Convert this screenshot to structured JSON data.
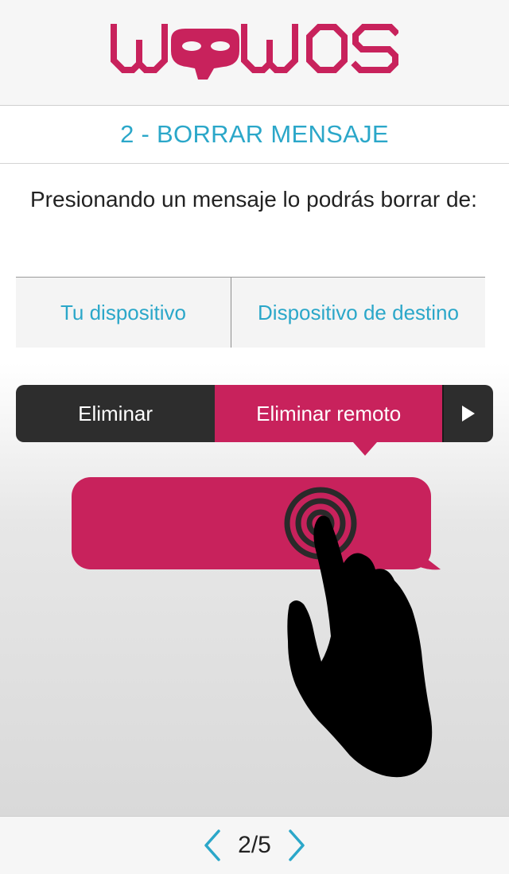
{
  "app": {
    "logo_text": "WOOWOS",
    "brand_color": "#c8225c",
    "accent_color": "#2ba7c9"
  },
  "page": {
    "title": "2 - BORRAR MENSAJE",
    "description": "Presionando un mensaje lo podrás borrar de:"
  },
  "options": {
    "left": "Tu dispositivo",
    "right": "Dispositivo de destino"
  },
  "context_menu": {
    "delete_label": "Eliminar",
    "remote_delete_label": "Eliminar remoto",
    "more_icon": "play-arrow-icon"
  },
  "illustration": {
    "bubble_icon": "message-bubble",
    "gesture_icon": "hand-tap-icon"
  },
  "pagination": {
    "current": "2/5",
    "prev_icon": "chevron-left-icon",
    "next_icon": "chevron-right-icon"
  }
}
